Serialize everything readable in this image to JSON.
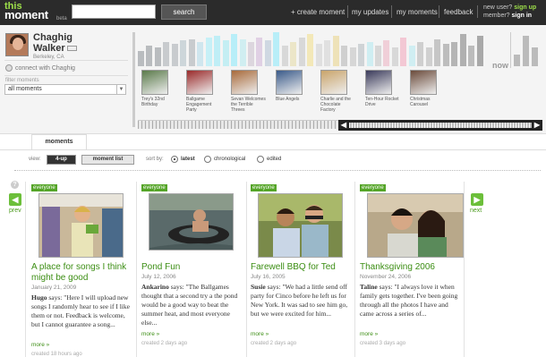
{
  "app": {
    "logo_line1": "this",
    "logo_line2": "moment",
    "logo_beta": "beta"
  },
  "search": {
    "value": "",
    "button": "search"
  },
  "nav": {
    "create": "+ create moment",
    "updates": "my updates",
    "moments": "my moments",
    "feedback": "feedback"
  },
  "account": {
    "new_user": "new user?",
    "sign_up": "sign up",
    "member": "member?",
    "sign_in": "sign in"
  },
  "profile": {
    "first_name": "Chaghig",
    "last_name": "Walker",
    "location": "Berkeley, CA",
    "connect": "connect with Chaghig"
  },
  "filter": {
    "label": "filter moments",
    "selected": "all moments"
  },
  "timeline": {
    "now_label": "now",
    "bars": [
      {
        "h": 0.45,
        "c": "#b9bcbf"
      },
      {
        "h": 0.6,
        "c": "#b9bcbf"
      },
      {
        "h": 0.55,
        "c": "#b9bcbf"
      },
      {
        "h": 0.7,
        "c": "#c8cbce"
      },
      {
        "h": 0.65,
        "c": "#c8cbce"
      },
      {
        "h": 0.75,
        "c": "#cdd6da"
      },
      {
        "h": 0.8,
        "c": "#c8cbce"
      },
      {
        "h": 0.7,
        "c": "#cfe6ee"
      },
      {
        "h": 0.85,
        "c": "#c6f0f7"
      },
      {
        "h": 0.9,
        "c": "#bfeef6"
      },
      {
        "h": 0.75,
        "c": "#c4eef3"
      },
      {
        "h": 0.95,
        "c": "#b8eef8"
      },
      {
        "h": 0.8,
        "c": "#d0eef1"
      },
      {
        "h": 0.7,
        "c": "#dcd6de"
      },
      {
        "h": 0.85,
        "c": "#e0d0e4"
      },
      {
        "h": 0.75,
        "c": "#cfd8e2"
      },
      {
        "h": 1.0,
        "c": "#b8eef8"
      },
      {
        "h": 0.6,
        "c": "#d8d8d8"
      },
      {
        "h": 0.7,
        "c": "#ece6c8"
      },
      {
        "h": 0.85,
        "c": "#d8d8d8"
      },
      {
        "h": 0.95,
        "c": "#f3e8b8"
      },
      {
        "h": 0.65,
        "c": "#e0e0e0"
      },
      {
        "h": 0.75,
        "c": "#e0e0e0"
      },
      {
        "h": 0.9,
        "c": "#eee2b8"
      },
      {
        "h": 0.6,
        "c": "#cfcfcf"
      },
      {
        "h": 0.55,
        "c": "#d6d6d6"
      },
      {
        "h": 0.65,
        "c": "#cfd3d6"
      },
      {
        "h": 0.7,
        "c": "#cfeef2"
      },
      {
        "h": 0.6,
        "c": "#d8d8d8"
      },
      {
        "h": 0.75,
        "c": "#f0cfd8"
      },
      {
        "h": 0.55,
        "c": "#d8d8d8"
      },
      {
        "h": 0.85,
        "c": "#f3c8d4"
      },
      {
        "h": 0.6,
        "c": "#d0eef2"
      },
      {
        "h": 0.7,
        "c": "#cfcfcf"
      },
      {
        "h": 0.55,
        "c": "#d0d0d0"
      },
      {
        "h": 0.8,
        "c": "#c6c6c6"
      },
      {
        "h": 0.65,
        "c": "#bdbdbd"
      },
      {
        "h": 0.7,
        "c": "#b5b5b5"
      },
      {
        "h": 0.95,
        "c": "#b0b0b0"
      },
      {
        "h": 0.6,
        "c": "#bcbcbc"
      },
      {
        "h": 0.9,
        "c": "#a9a9a9"
      }
    ],
    "now_bars": [
      0.35,
      0.9,
      0.55
    ],
    "thumbs": [
      {
        "caption": "Trey's 32nd Birthday",
        "color": "#5a7a4a"
      },
      {
        "caption": "Ballgame Engagement Party",
        "color": "#9a2a2a"
      },
      {
        "caption": "Sevan Welcomes the Terrible Threes",
        "color": "#a86a3a"
      },
      {
        "caption": "Blue Angels",
        "color": "#3a5a8a"
      },
      {
        "caption": "Charlie and the Chocolate Factory",
        "color": "#c9a46a"
      },
      {
        "caption": "Ten-Hour Rocket Drive",
        "color": "#3a3a5a"
      },
      {
        "caption": "Christmas Carousel",
        "color": "#6a4a3a"
      }
    ]
  },
  "tabs": {
    "moments": "moments"
  },
  "viewbar": {
    "view_label": "view:",
    "view_4up": "4-up",
    "view_list": "moment list",
    "sort_label": "sort by:",
    "sort_latest": "latest",
    "sort_chrono": "chronological",
    "sort_edited": "edited"
  },
  "pager": {
    "prev": "prev",
    "next": "next",
    "help": "?"
  },
  "cards": [
    {
      "visibility": "everyone",
      "title": "A place for songs I think might be good",
      "date": "January 21, 2009",
      "author": "Hugo",
      "says": " says: \"Here I will upload new songs I randomly hear to see if I like them or not. Feedback is welcome, but I cannot guarantee a song...",
      "more": "more »",
      "created": "created 18 hours ago"
    },
    {
      "visibility": "everyone",
      "title": "Pond Fun",
      "date": "July 12, 2006",
      "author": "Ankarino",
      "says": " says: \"The Ballgames thought that a second try a the pond would be a good way to beat the summer heat, and most everyone else...",
      "more": "more »",
      "created": "created 2 days ago"
    },
    {
      "visibility": "everyone",
      "title": "Farewell BBQ for Ted",
      "date": "July 16, 2005",
      "author": "Susie",
      "says": " says: \"We had a little send off party for Cinco before he left us for New York. It was sad to see him go, but we were excited for him...",
      "more": "more »",
      "created": "created 2 days ago"
    },
    {
      "visibility": "everyone",
      "title": "Thanksgiving 2006",
      "date": "November 24, 2006",
      "author": "Taline",
      "says": " says: \"I always love it when family gets together. I've been going through all the photos I have and came across a series of...",
      "more": "more »",
      "created": "created 3 days ago"
    }
  ]
}
